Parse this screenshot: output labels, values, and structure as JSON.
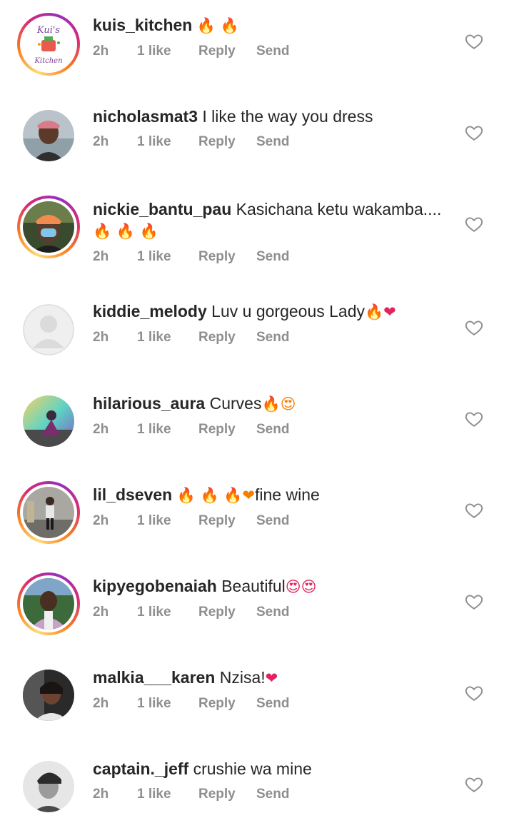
{
  "comments": [
    {
      "username": "kuis_kitchen",
      "text": "",
      "emoji": "🔥 🔥",
      "time": "2h",
      "likes": "1 like",
      "reply": "Reply",
      "send": "Send",
      "avatar_text": "Kui's",
      "avatar_text2": "Kitchen"
    },
    {
      "username": "nicholasmat3",
      "text": " I like the way you dress",
      "emoji": "",
      "time": "2h",
      "likes": "1 like",
      "reply": "Reply",
      "send": "Send"
    },
    {
      "username": "nickie_bantu_pau",
      "text": " Kasichana ketu wakamba....",
      "emoji": "🔥 🔥 🔥",
      "time": "2h",
      "likes": "1 like",
      "reply": "Reply",
      "send": "Send"
    },
    {
      "username": "kiddie_melody",
      "text": " Luv u gorgeous Lady",
      "emoji": "🔥❤",
      "time": "2h",
      "likes": "1 like",
      "reply": "Reply",
      "send": "Send"
    },
    {
      "username": "hilarious_aura",
      "text": " Curves",
      "emoji": "🔥😍",
      "time": "2h",
      "likes": "1 like",
      "reply": "Reply",
      "send": "Send"
    },
    {
      "username": "lil_dseven",
      "text": "fine wine",
      "emoji": "🔥 🔥 🔥❤",
      "time": "2h",
      "likes": "1 like",
      "reply": "Reply",
      "send": "Send"
    },
    {
      "username": "kipyegobenaiah",
      "text": " Beautiful",
      "emoji": "😍😍",
      "time": "2h",
      "likes": "1 like",
      "reply": "Reply",
      "send": "Send"
    },
    {
      "username": "malkia___karen",
      "text": " Nzisa!",
      "emoji": "❤",
      "time": "2h",
      "likes": "1 like",
      "reply": "Reply",
      "send": "Send"
    },
    {
      "username": "captain._jeff",
      "text": " crushie wa mine",
      "emoji": "",
      "time": "2h",
      "likes": "1 like",
      "reply": "Reply",
      "send": "Send"
    }
  ],
  "colors": {
    "text": "#262626",
    "meta": "#8e8e8e",
    "fire": "#f77f00",
    "heart": "#e0245e",
    "heart_outline": "#8e8e8e"
  }
}
